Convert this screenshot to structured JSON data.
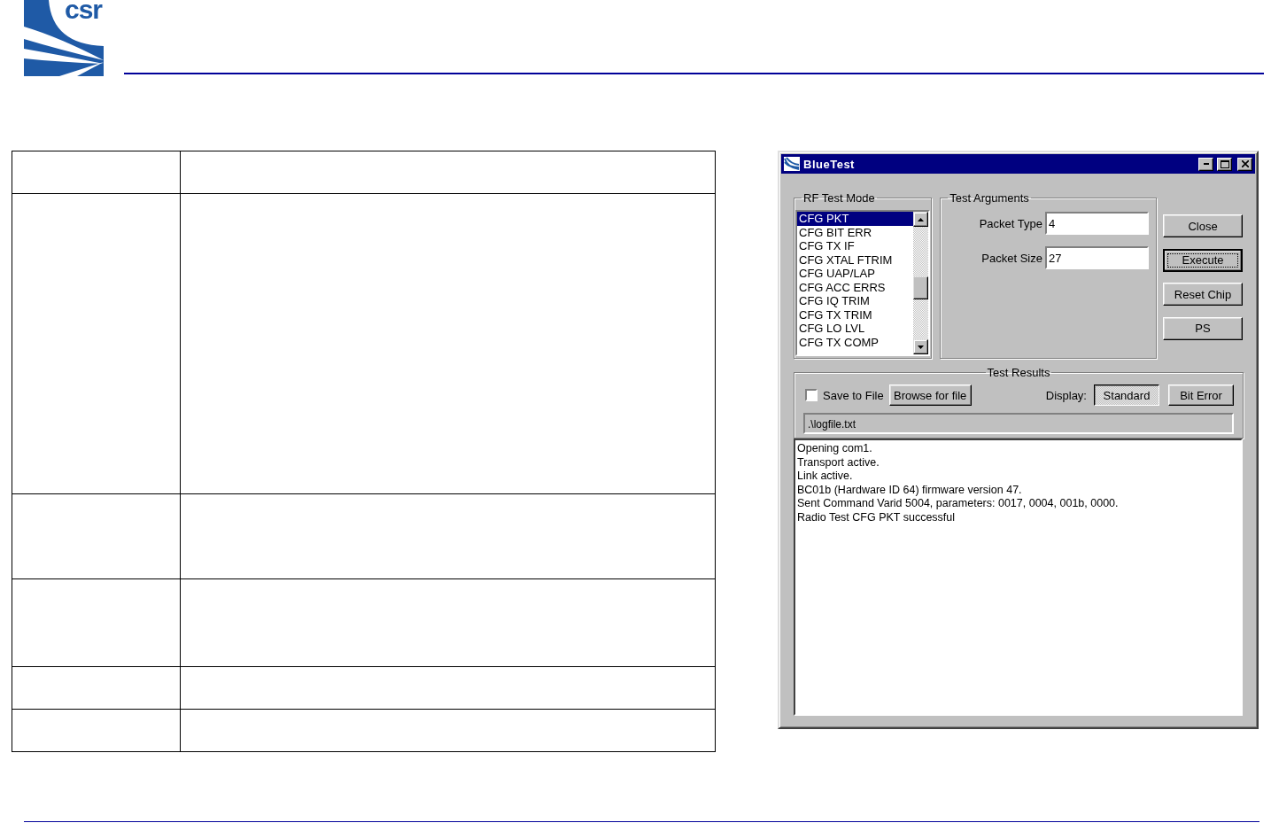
{
  "logo": {
    "text": "csr"
  },
  "window": {
    "title": "BlueTest"
  },
  "rf_test_mode": {
    "label": "RF Test Mode",
    "items": [
      {
        "label": "CFG PKT",
        "selected": true
      },
      {
        "label": "CFG BIT ERR",
        "selected": false
      },
      {
        "label": "CFG TX IF",
        "selected": false
      },
      {
        "label": "CFG XTAL FTRIM",
        "selected": false
      },
      {
        "label": "CFG UAP/LAP",
        "selected": false
      },
      {
        "label": "CFG ACC ERRS",
        "selected": false
      },
      {
        "label": "CFG IQ TRIM",
        "selected": false
      },
      {
        "label": "CFG TX TRIM",
        "selected": false
      },
      {
        "label": "CFG LO LVL",
        "selected": false
      },
      {
        "label": "CFG TX COMP",
        "selected": false
      }
    ]
  },
  "test_arguments": {
    "label": "Test Arguments",
    "fields": [
      {
        "label": "Packet Type",
        "value": "4"
      },
      {
        "label": "Packet Size",
        "value": "27"
      }
    ]
  },
  "buttons": [
    {
      "label": "Close",
      "focused": false
    },
    {
      "label": "Execute",
      "focused": true
    },
    {
      "label": "Reset Chip",
      "focused": false
    },
    {
      "label": "PS",
      "focused": false
    }
  ],
  "test_results": {
    "label": "Test Results",
    "save_to_file": {
      "label": "Save to File",
      "checked": false
    },
    "browse_button": "Browse for file",
    "display_label": "Display:",
    "display_options": [
      {
        "label": "Standard",
        "selected": true
      },
      {
        "label": "Bit Error",
        "selected": false
      }
    ],
    "file_path": ".\\logfile.txt",
    "log": [
      "Opening com1.",
      "Transport active.",
      "Link active.",
      "BC01b (Hardware ID 64) firmware version 47.",
      "Sent Command Varid 5004, parameters: 0017, 0004, 001b, 0000.",
      "Radio Test CFG PKT successful"
    ]
  }
}
